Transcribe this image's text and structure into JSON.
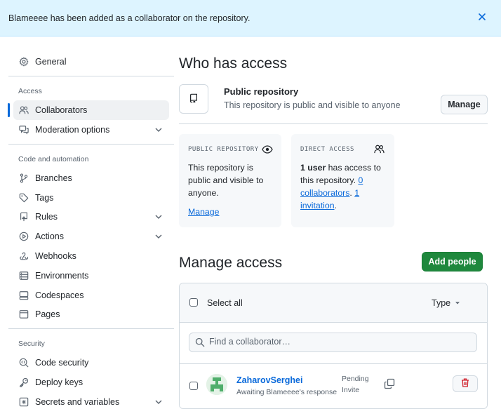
{
  "flash": {
    "message": "Blameeee has been added as a collaborator on the repository."
  },
  "sidebar": {
    "general": "General",
    "sections": [
      {
        "heading": "Access",
        "items": [
          "Collaborators",
          "Moderation options"
        ]
      },
      {
        "heading": "Code and automation",
        "items": [
          "Branches",
          "Tags",
          "Rules",
          "Actions",
          "Webhooks",
          "Environments",
          "Codespaces",
          "Pages"
        ]
      },
      {
        "heading": "Security",
        "items": [
          "Code security",
          "Deploy keys",
          "Secrets and variables"
        ]
      }
    ],
    "active_item": "Collaborators"
  },
  "who_has_access": {
    "title": "Who has access",
    "repo_title": "Public repository",
    "repo_subtitle": "This repository is public and visible to anyone",
    "manage_button": "Manage",
    "public_card": {
      "label": "PUBLIC REPOSITORY",
      "line1": "This repository is",
      "line2": "public and visible to",
      "line3": "anyone.",
      "link": "Manage"
    },
    "direct_card": {
      "label": "DIRECT ACCESS",
      "bold": "1 user",
      "line1_rest": " has access to",
      "line2_pre": "this repository. ",
      "zero": "0",
      "collaborators": "collaborators",
      "sep": ". ",
      "one": "1",
      "invitation": "invitation",
      "end": "."
    }
  },
  "manage_access": {
    "title": "Manage access",
    "add_button": "Add people",
    "select_all": "Select all",
    "type_filter": "Type",
    "search_placeholder": "Find a collaborator…",
    "members": [
      {
        "name": "ZaharovSerghei",
        "status": "Awaiting Blameeee's response",
        "role_line1": "Pending",
        "role_line2": "Invite"
      }
    ]
  },
  "colors": {
    "accent": "#0969da",
    "primary_button": "#1f883d",
    "flash_bg": "#ddf4ff",
    "danger": "#d1242f"
  }
}
